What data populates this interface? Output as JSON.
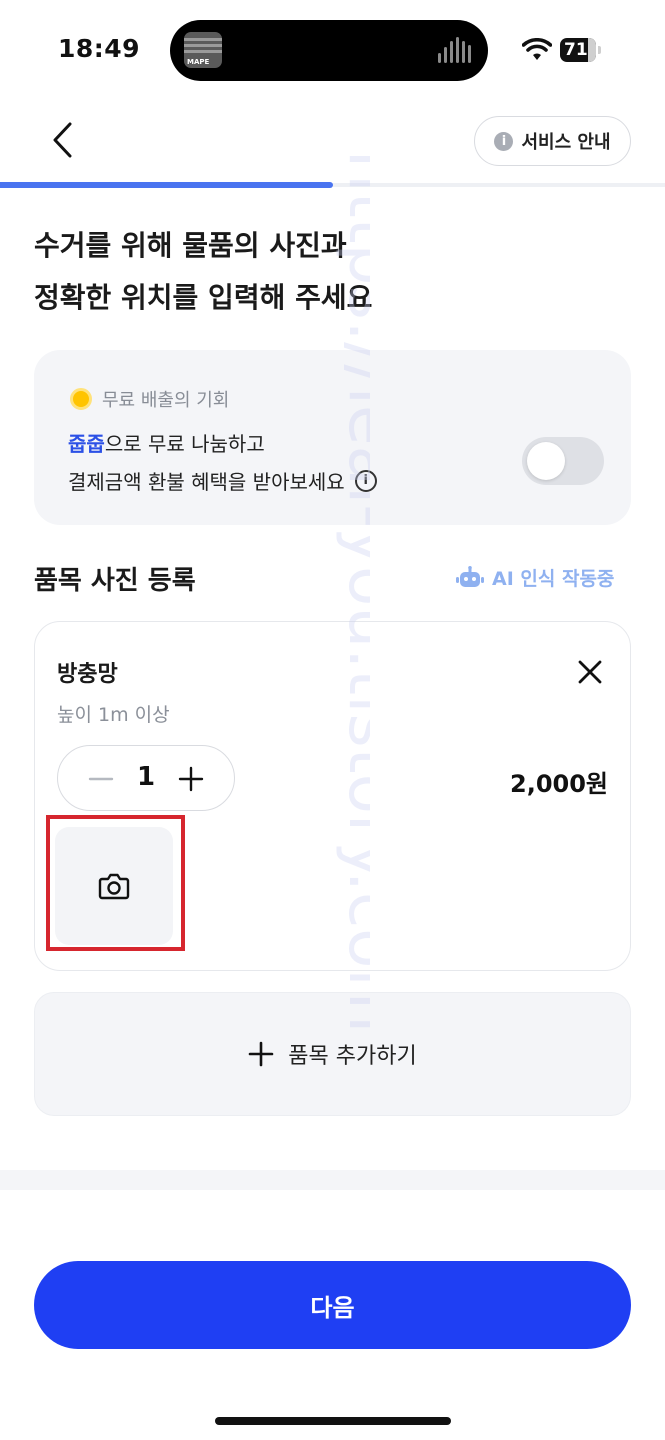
{
  "status_bar": {
    "time": "18:49",
    "album_art_text": "MAPE",
    "battery_level": "71"
  },
  "header": {
    "back_icon": "chevron-left-icon",
    "service_button_label": "서비스 안내",
    "service_info_icon": "i"
  },
  "progress": {
    "fraction": 0.5,
    "color": "#4a74f0"
  },
  "title": {
    "line1": "수거를 위해 물품의 사진과",
    "line2": "정확한 위치를 입력해 주세요"
  },
  "free_offer": {
    "tag": "무료 배출의 기회",
    "brand": "줍줍",
    "line1_rest": "으로 무료 나눔하고",
    "line2": "결제금액 환불 혜택을 받아보세요",
    "info_icon": "i",
    "toggle_on": false
  },
  "photo_section": {
    "title": "품목 사진 등록",
    "ai_badge": "AI 인식 작동중"
  },
  "item": {
    "name": "방충망",
    "subtitle": "높이 1m 이상",
    "quantity": "1",
    "price": "2,000원"
  },
  "add_item_label": "품목 추가하기",
  "next_button_label": "다음",
  "watermark_text": "https://leal-you.tistory.com",
  "colors": {
    "primary": "#1f3ff3",
    "brand_text": "#2b50e6",
    "ai_badge": "#8fb1f0",
    "highlight": "#d6262e"
  }
}
